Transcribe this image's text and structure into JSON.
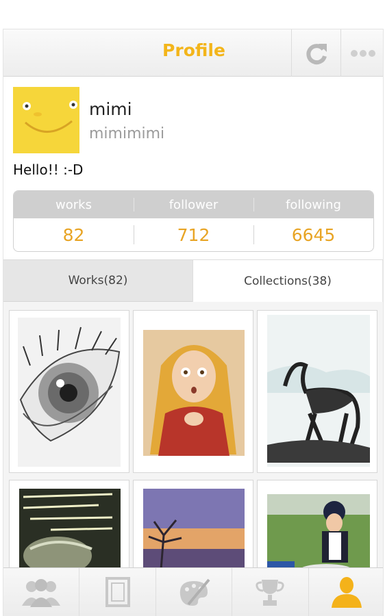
{
  "header": {
    "title": "Profile",
    "refresh_icon": "refresh-icon",
    "more_icon": "more-dots-icon",
    "accent_color": "#f3b51b"
  },
  "profile": {
    "name": "mimi",
    "handle": "mimimimi",
    "bio": "Hello!! :-D"
  },
  "stats": {
    "labels": [
      "works",
      "follower",
      "following"
    ],
    "values": [
      "82",
      "712",
      "6645"
    ],
    "value_color": "#e8a424"
  },
  "tabs": [
    {
      "label": "Works(82)",
      "active": false
    },
    {
      "label": "Collections(38)",
      "active": true
    }
  ],
  "gallery": [
    {
      "subject": "eye pencil sketch"
    },
    {
      "subject": "blonde girl illustration"
    },
    {
      "subject": "horse ink drawing"
    },
    {
      "subject": "face with handwritten text"
    },
    {
      "subject": "tree at sunset watercolor"
    },
    {
      "subject": "child in riding helmet photo"
    }
  ],
  "bottom_nav": [
    {
      "icon": "people-icon",
      "active": false
    },
    {
      "icon": "frame-icon",
      "active": false
    },
    {
      "icon": "palette-icon",
      "active": false
    },
    {
      "icon": "trophy-icon",
      "active": false
    },
    {
      "icon": "user-icon",
      "active": true
    }
  ]
}
